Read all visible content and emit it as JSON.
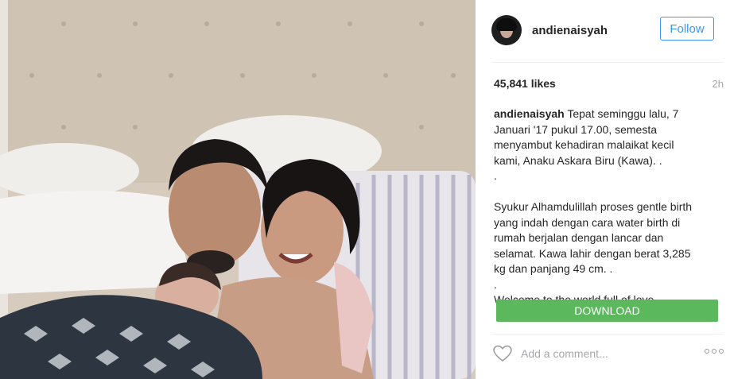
{
  "post": {
    "username": "andienaisyah",
    "follow_label": "Follow",
    "likes": "45,841 likes",
    "time_ago": "2h",
    "caption": {
      "username": "andienaisyah",
      "line1": "Tepat seminggu lalu, 7 Januari '17 pukul 17.00, semesta menyambut kehadiran malaikat kecil kami, Anaku Askara Biru (Kawa). .",
      "dot1": ".",
      "para2": "Syukur Alhamdulillah proses gentle birth yang indah dengan cara water birth di rumah berjalan dengan lancar dan selamat. Kawa lahir dengan berat 3,285 kg dan panjang 49 cm. .",
      "dot2": ".",
      "para3": "Welcome to the world full of love,"
    },
    "download_label": "DOWNLOAD",
    "comment_placeholder": "Add a comment...",
    "icons": {
      "like": "heart-icon",
      "more": "more-options-icon"
    }
  }
}
